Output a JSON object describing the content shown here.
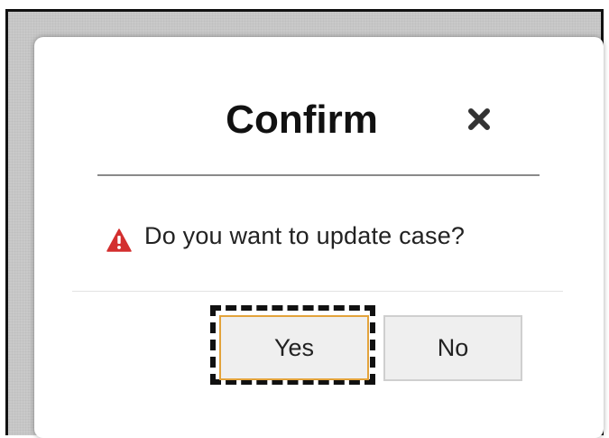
{
  "dialog": {
    "title": "Confirm",
    "close_icon": "close-icon",
    "message": "Do you want to update case?",
    "message_icon": "warning-icon",
    "buttons": {
      "yes_label": "Yes",
      "no_label": "No"
    }
  },
  "colors": {
    "warning": "#d32f2f",
    "focus_border": "#e3a33b",
    "button_background": "#efefef"
  }
}
